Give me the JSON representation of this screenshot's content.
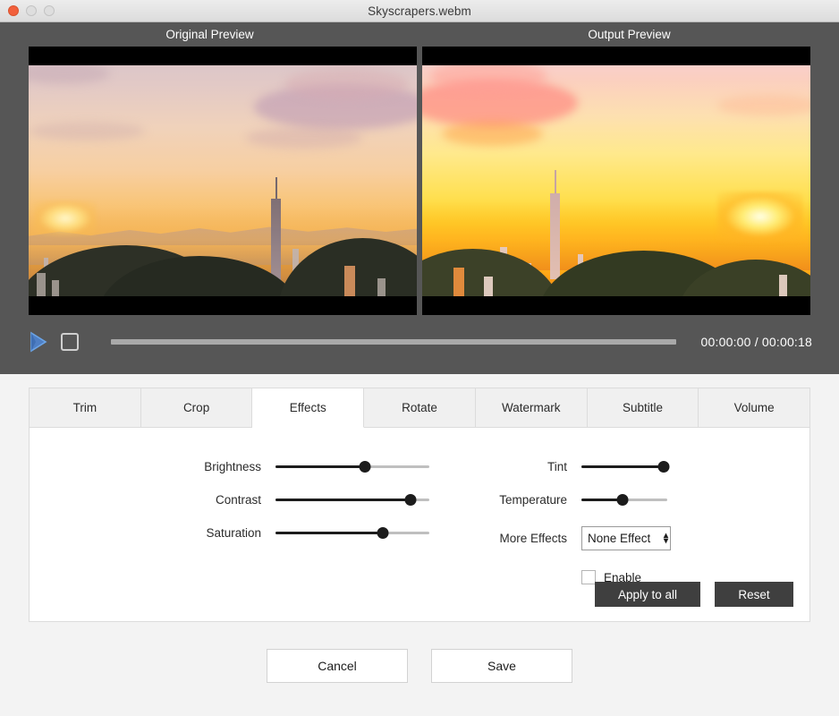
{
  "window": {
    "title": "Skyscrapers.webm",
    "traffic_lights": [
      "close",
      "minimize",
      "maximize"
    ]
  },
  "preview": {
    "original_label": "Original Preview",
    "output_label": "Output  Preview"
  },
  "transport": {
    "play_icon": "play-icon",
    "stop_icon": "stop-icon",
    "progress_percent": 0,
    "timecode": "00:00:00 / 00:00:18",
    "current_time": "00:00:00",
    "duration": "00:00:18"
  },
  "tabs": [
    {
      "label": "Trim",
      "active": false
    },
    {
      "label": "Crop",
      "active": false
    },
    {
      "label": "Effects",
      "active": true
    },
    {
      "label": "Rotate",
      "active": false
    },
    {
      "label": "Watermark",
      "active": false
    },
    {
      "label": "Subtitle",
      "active": false
    },
    {
      "label": "Volume",
      "active": false
    }
  ],
  "effects": {
    "left_sliders": [
      {
        "label": "Brightness",
        "value": 58
      },
      {
        "label": "Contrast",
        "value": 88
      },
      {
        "label": "Saturation",
        "value": 70
      }
    ],
    "right_sliders": [
      {
        "label": "Tint",
        "value": 96
      },
      {
        "label": "Temperature",
        "value": 48
      }
    ],
    "more_effects": {
      "label": "More Effects",
      "selected": "None Effect",
      "options": [
        "None Effect"
      ],
      "stepper_up": "▴",
      "stepper_down": "▾"
    },
    "enable": {
      "label": "Enable",
      "checked": false
    },
    "apply_all_label": "Apply to all",
    "reset_label": "Reset"
  },
  "footer": {
    "cancel_label": "Cancel",
    "save_label": "Save"
  },
  "colors": {
    "titlebar": "#e4e4e4",
    "dark_panel": "#565656",
    "page_bg": "#f3f3f3",
    "accent_play": "#4a87d3",
    "close_light": "#f2603c",
    "dark_button": "#3f3f3f",
    "slider_active": "#1c1c1c",
    "slider_track": "#bfbfbf"
  }
}
